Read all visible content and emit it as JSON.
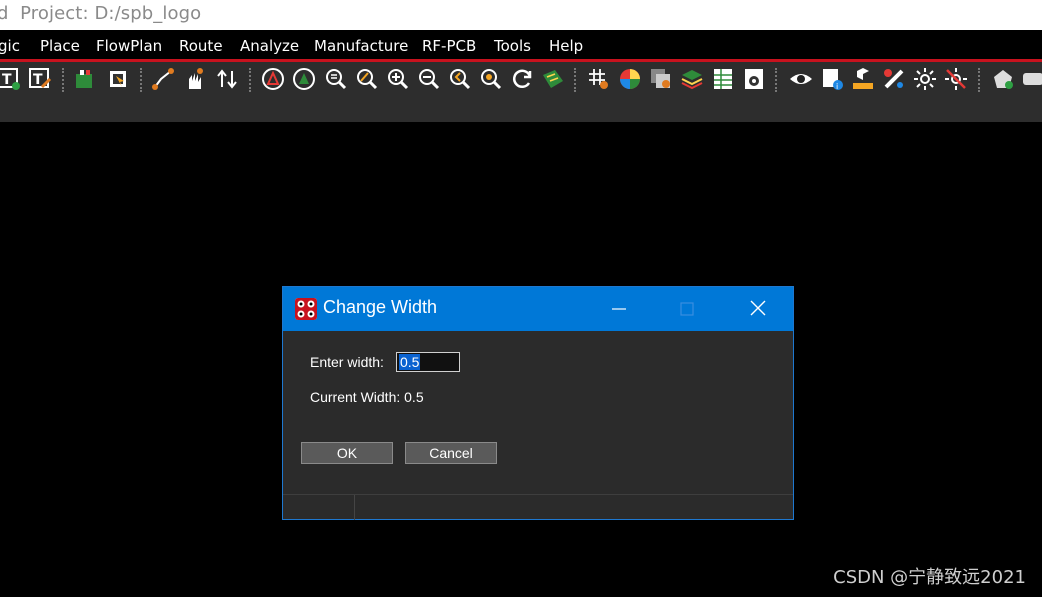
{
  "window": {
    "title": "d  Project: D:/spb_logo"
  },
  "menu": [
    "gic",
    "Place",
    "FlowPlan",
    "Route",
    "Analyze",
    "Manufacture",
    "RF-PCB",
    "Tools",
    "Help"
  ],
  "toolbar": {
    "icons": [
      "text-add-icon",
      "text-edit-icon",
      "component-green-icon",
      "component-select-icon",
      "route-connect-icon",
      "slide-hand-icon",
      "swap-arrows-icon",
      "drc-red-icon",
      "drc-green-icon",
      "zoom-fit-icon",
      "zoom-pen-icon",
      "zoom-in-icon",
      "zoom-out-icon",
      "zoom-previous-icon",
      "zoom-center-icon",
      "refresh-icon",
      "board-3d-icon",
      "grid-icon",
      "color-wheel-icon",
      "shadow-icon",
      "layers-icon",
      "spreadsheet-icon",
      "settings-doc-icon",
      "visibility-eye-icon",
      "info-doc-icon",
      "measure-icon",
      "edit-brush-icon",
      "brightness-icon",
      "brightness-off-icon",
      "shape-add-icon",
      "shape-more-icon"
    ]
  },
  "dialog": {
    "title": "Change Width",
    "enter_width_label": "Enter width:",
    "width_value": "0.5",
    "current_width_label": "Current Width: 0.5",
    "ok_label": "OK",
    "cancel_label": "Cancel"
  },
  "watermark": "CSDN @宁静致远2021",
  "colors": {
    "accent": "#0078d7",
    "menu_underline": "#c8121e",
    "toolbar_bg": "#2d2d2d",
    "dialog_bg": "#2b2b2b"
  }
}
